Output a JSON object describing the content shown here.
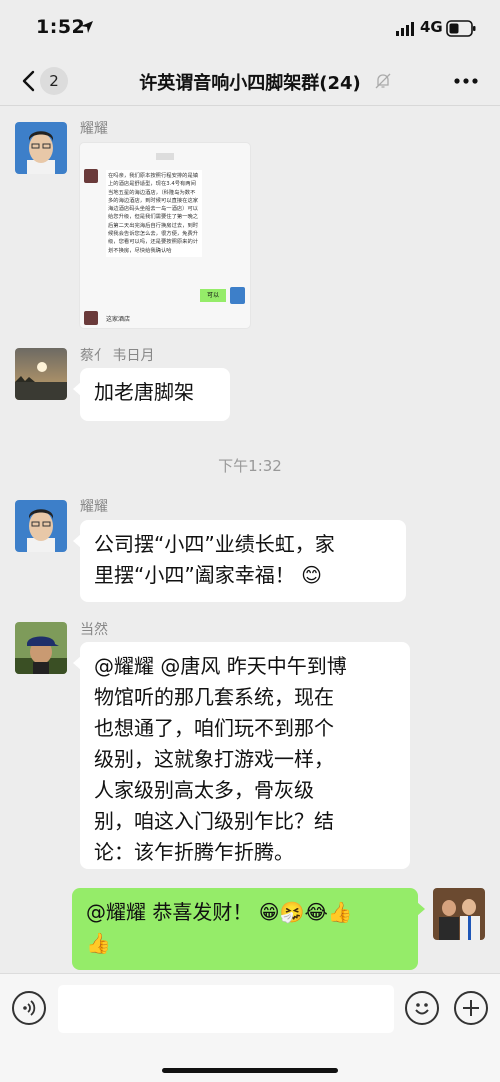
{
  "status": {
    "time": "1:52",
    "network": "4G"
  },
  "nav": {
    "unread": "2",
    "title": "许英谓音响小四脚架群(24)"
  },
  "messages": {
    "m1": {
      "sender": "耀耀",
      "image_text": "在吗亲，我们原本按照行程安排的是镇上的酒店是舒适型，现在3.4号有两间当地五星的海边酒店，（科隆岛为数不多的海边酒店，到时候可以直接在这家海边酒店码头坐船去一岛一酒店）可以给您升级，但是我们需要住了第一晚之后第二天出完海后自行换房过去，到时候我会告诉您怎么去，很方便，免费升级，您看可以吗，还是要按照原来的计划不换房，尽快给我确认哈",
      "image_reply": "可以",
      "image_caption": "这家酒店"
    },
    "m2": {
      "sender": "蔡亻 韦日月",
      "text": "加老唐脚架"
    },
    "time_sep": "下午1:32",
    "m3": {
      "sender": "耀耀",
      "line1": "公司摆“小四”业绩长虹，家",
      "line2": "里摆“小四”阖家幸福！ 😊"
    },
    "m4": {
      "sender": "当然",
      "lines": [
        "@耀耀 @唐风 昨天中午到博",
        "物馆听的那几套系统，现在",
        "也想通了，咱们玩不到那个",
        "级别，这就象打游戏一样，",
        "人家级别高太多，骨灰级",
        "别，咱这入门级别乍比？结",
        "论：该乍折腾乍折腾。"
      ]
    },
    "m5": {
      "line1": "@耀耀 恭喜发财！ 😁🤧😂👍",
      "line2": "👍"
    }
  },
  "icons": {
    "back": "chevron-left-icon",
    "mute": "bell-muted-icon",
    "more": "more-dots-icon",
    "voice": "voice-icon",
    "emoji": "emoji-icon",
    "plus": "plus-icon"
  },
  "colors": {
    "background": "#ededed",
    "my_bubble": "#95ec69",
    "other_bubble": "#ffffff"
  }
}
